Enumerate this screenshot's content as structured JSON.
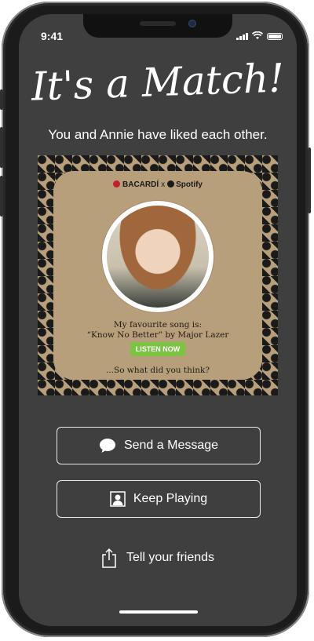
{
  "status_bar": {
    "time": "9:41"
  },
  "match": {
    "title": "It's a Match!",
    "subtitle": "You and Annie have liked each other."
  },
  "card": {
    "brand_left": "BACARDÍ",
    "brand_separator": "x",
    "brand_right": "Spotify",
    "song_intro": "My favourite song is:",
    "song_title": "“Know No Better” by Major Lazer",
    "listen_label": "LISTEN NOW",
    "question": "...So what did you think?"
  },
  "actions": {
    "send_message": "Send a Message",
    "keep_playing": "Keep Playing",
    "tell_friends": "Tell your friends"
  },
  "colors": {
    "screen_bg": "#3f3f3f",
    "card_bg": "#b89f7c",
    "listen_button": "#7cc243",
    "bacardi_red": "#c31f2e"
  },
  "icons": [
    "chat-bubble-icon",
    "person-icon",
    "share-icon",
    "cellular-icon",
    "wifi-icon",
    "battery-icon"
  ]
}
